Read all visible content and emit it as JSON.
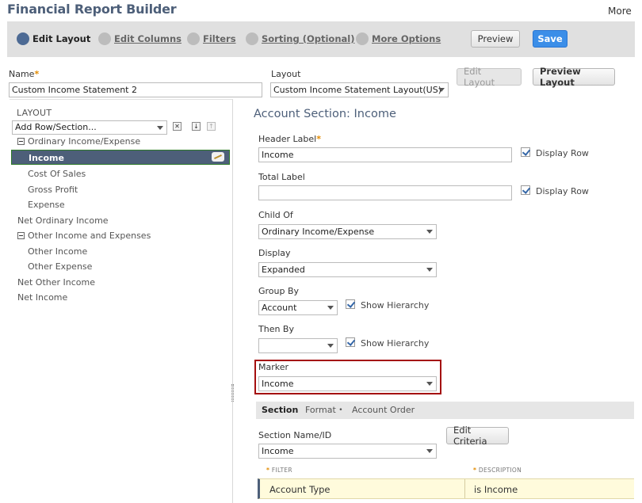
{
  "header": {
    "title": "Financial Report Builder",
    "more": "More"
  },
  "steps": [
    {
      "label": "Edit Layout",
      "active": true
    },
    {
      "label": "Edit Columns",
      "active": false
    },
    {
      "label": "Filters",
      "active": false
    },
    {
      "label": "Sorting (Optional)",
      "active": false
    },
    {
      "label": "More Options",
      "active": false
    }
  ],
  "toolbar": {
    "preview": "Preview",
    "save": "Save"
  },
  "report": {
    "name_label": "Name",
    "name_value": "Custom Income Statement 2",
    "layout_label": "Layout",
    "layout_value": "Custom Income Statement Layout(US)",
    "edit_layout": "Edit Layout",
    "preview_layout": "Preview Layout"
  },
  "left": {
    "heading": "LAYOUT",
    "add_row": "Add Row/Section...",
    "tree": [
      {
        "label": "Ordinary Income/Expense",
        "level": 0,
        "collapsible": true
      },
      {
        "label": "Income",
        "level": 1,
        "selected": true
      },
      {
        "label": "Cost Of Sales",
        "level": 1
      },
      {
        "label": "Gross Profit",
        "level": 1
      },
      {
        "label": "Expense",
        "level": 1
      },
      {
        "label": "Net Ordinary Income",
        "level": 0
      },
      {
        "label": "Other Income and Expenses",
        "level": 0,
        "collapsible": true
      },
      {
        "label": "Other Income",
        "level": 1
      },
      {
        "label": "Other Expense",
        "level": 1
      },
      {
        "label": "Net Other Income",
        "level": 0
      },
      {
        "label": "Net Income",
        "level": 0
      }
    ]
  },
  "section": {
    "title": "Account Section: Income",
    "header_label": "Header Label",
    "header_value": "Income",
    "display_row": "Display Row",
    "total_label": "Total Label",
    "total_value": "",
    "child_of_label": "Child Of",
    "child_of_value": "Ordinary Income/Expense",
    "display_label": "Display",
    "display_value": "Expanded",
    "group_by_label": "Group By",
    "group_by_value": "Account",
    "show_hierarchy": "Show Hierarchy",
    "then_by_label": "Then By",
    "then_by_value": "",
    "marker_label": "Marker",
    "marker_value": "Income"
  },
  "subtabs": {
    "section": "Section",
    "format": "Format",
    "format_mark": "•",
    "account_order": "Account Order"
  },
  "criteria": {
    "name_label": "Section Name/ID",
    "name_value": "Income",
    "edit_criteria": "Edit Criteria",
    "col_filter": "FILTER",
    "col_description": "DESCRIPTION",
    "req_mark": "*",
    "rows": [
      {
        "filter": "Account Type",
        "description": "is Income"
      }
    ]
  }
}
